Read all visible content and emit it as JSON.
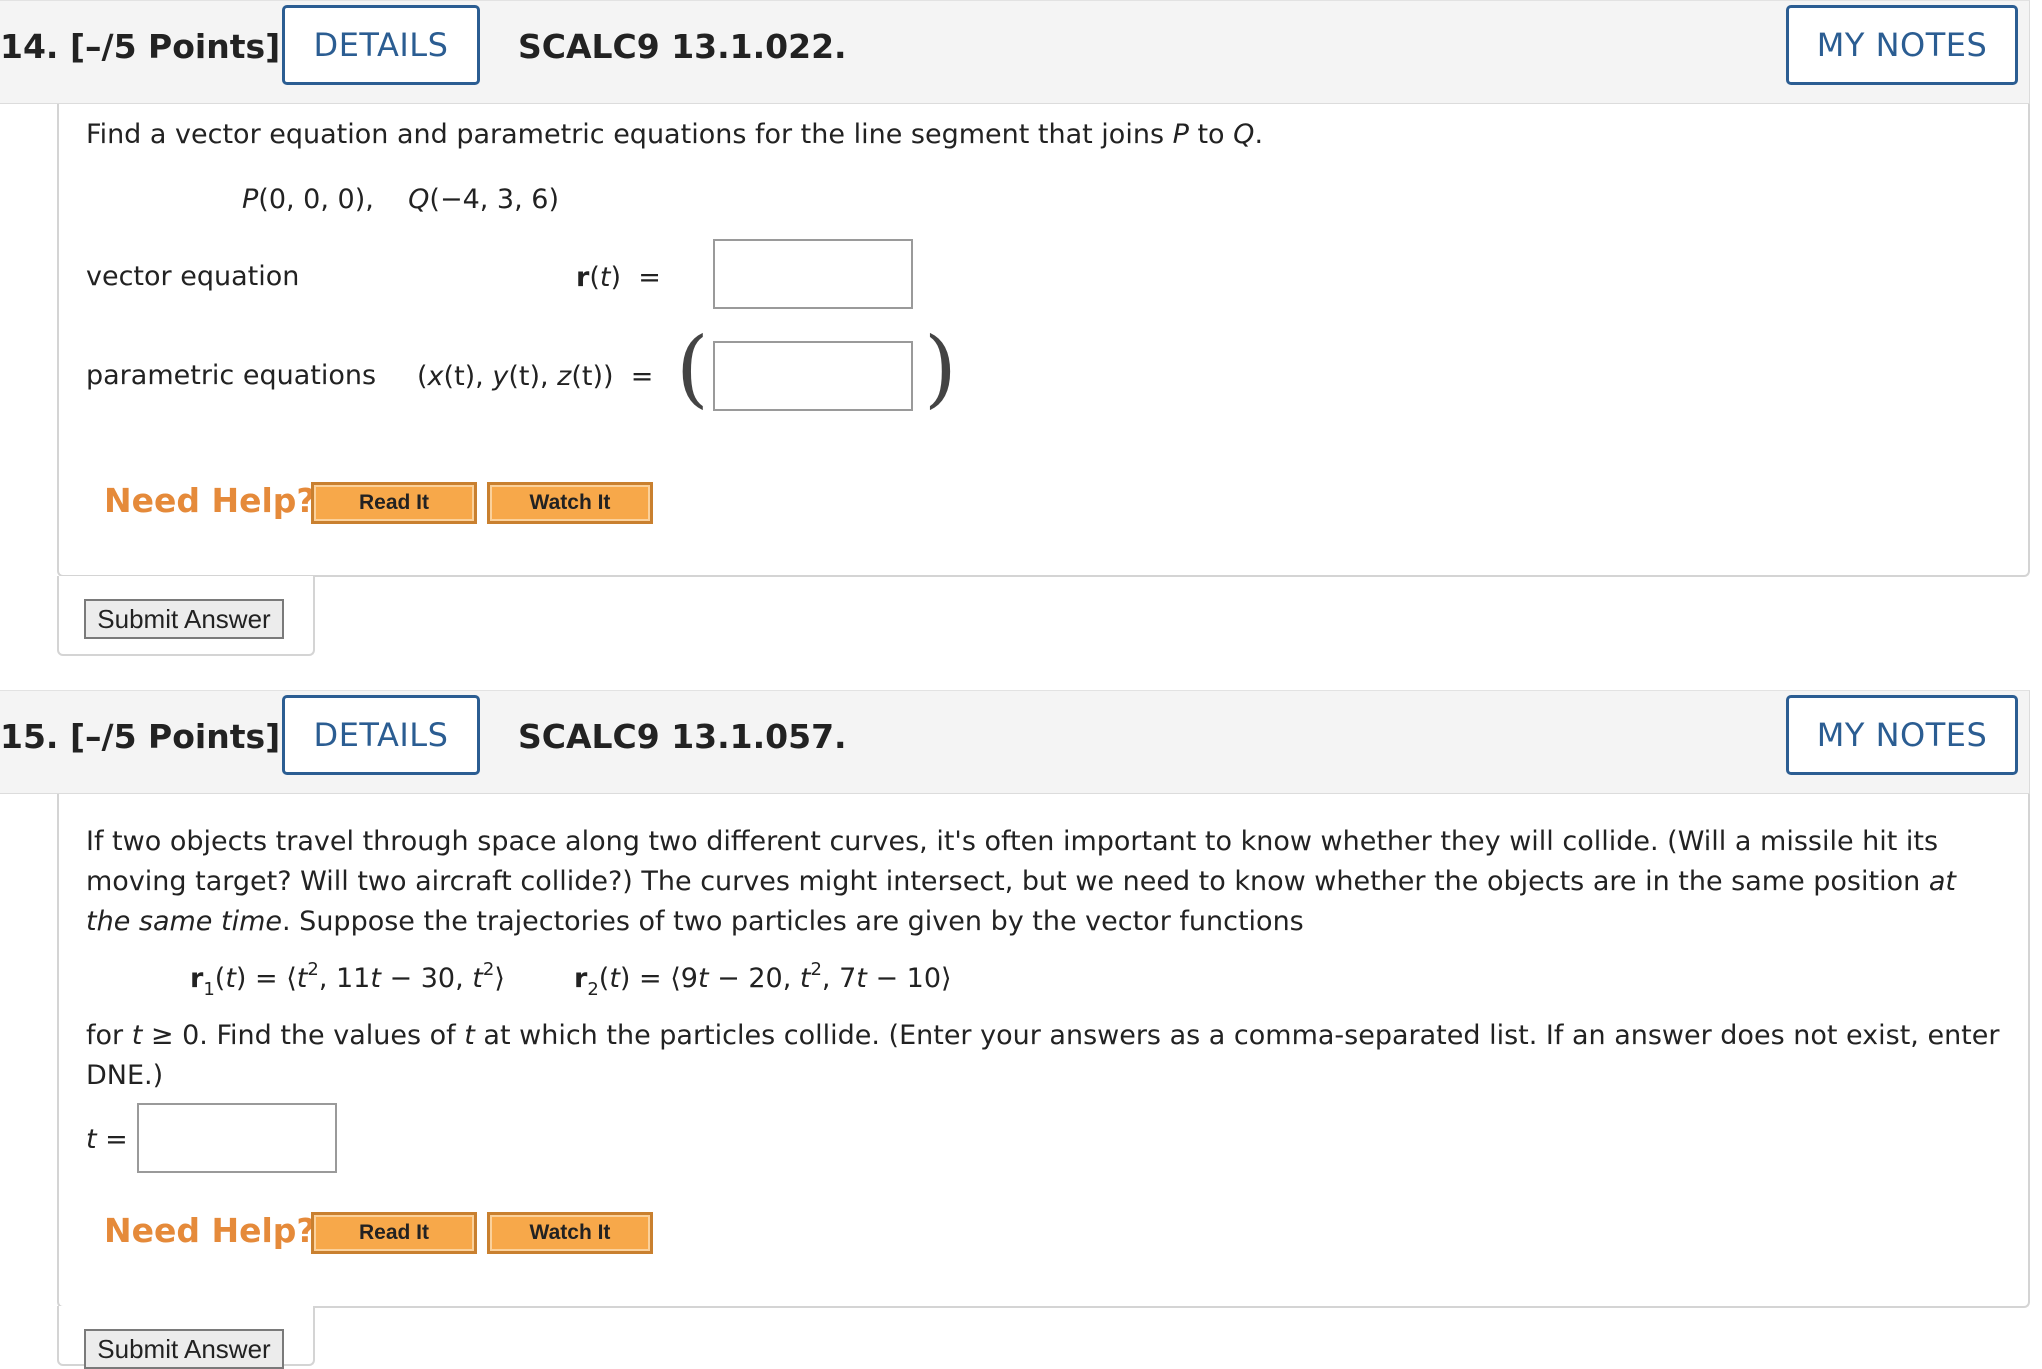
{
  "q14": {
    "number": "14.",
    "points": "[–/5 Points]",
    "details_label": "DETAILS",
    "code": "SCALC9 13.1.022.",
    "my_notes_label": "MY NOTES",
    "prompt": {
      "pre": "Find a vector equation and parametric equations for the line segment that joins ",
      "P": "P",
      "mid": " to ",
      "Q": "Q",
      "post": "."
    },
    "points_given": {
      "p_letter": "P",
      "p_coords": "(0, 0, 0),",
      "q_letter": "Q",
      "q_coords": "(−4, 3, 6)"
    },
    "vector_label": "vector equation",
    "vector_lhs": {
      "r": "r",
      "open": "(",
      "t": "t",
      "close": ")",
      "eq": "="
    },
    "parametric_label": "parametric equations",
    "parametric_lhs": {
      "open": "(",
      "x": "x",
      "tx": "(t), ",
      "y": "y",
      "ty": "(t), ",
      "z": "z",
      "tz": "(t))",
      "eq": "="
    },
    "vector_answer": "",
    "parametric_answer": "",
    "need_help": "Need Help?",
    "read_it": "Read It",
    "watch_it": "Watch It",
    "submit": "Submit Answer"
  },
  "q15": {
    "number": "15.",
    "points": "[–/5 Points]",
    "details_label": "DETAILS",
    "code": "SCALC9 13.1.057.",
    "my_notes_label": "MY NOTES",
    "para1_a": "If two objects travel through space along two different curves, it's often important to know whether they will collide. (Will a missile hit its moving target? Will two aircraft collide?) The curves might intersect, but we need to know whether the objects are in the same position ",
    "para1_it": "at the same time",
    "para1_b": ". Suppose the trajectories of two particles are given by the vector functions",
    "r1": {
      "r": "r",
      "sub": "1",
      "t_open": "(",
      "t": "t",
      "t_close": ") = ⟨",
      "c1": "t",
      "c1sup": "2",
      "c2pre": ", 11",
      "c2t": "t",
      "c2post": " − 30, ",
      "c3": "t",
      "c3sup": "2",
      "end": "⟩"
    },
    "r2": {
      "r": "r",
      "sub": "2",
      "t_open": "(",
      "t": "t",
      "t_close": ") = ⟨9",
      "c1t": "t",
      "c1post": " − 20, ",
      "c2": "t",
      "c2sup": "2",
      "c3pre": ", 7",
      "c3t": "t",
      "c3post": " − 10⟩"
    },
    "para2_a": "for ",
    "para2_t": "t",
    "para2_b": " ≥ 0. Find the values of ",
    "para2_t2": "t",
    "para2_c": " at which the particles collide. (Enter your answers as a comma-separated list. If an answer does not exist, enter DNE.)",
    "t_label": "t",
    "t_eq": " =",
    "t_answer": "",
    "need_help": "Need Help?",
    "read_it": "Read It",
    "watch_it": "Watch It",
    "submit": "Submit Answer"
  },
  "colors": {
    "accent_blue": "#2b5d92",
    "need_help_orange": "#e58a3a",
    "help_button_fill": "#f7a84a"
  }
}
